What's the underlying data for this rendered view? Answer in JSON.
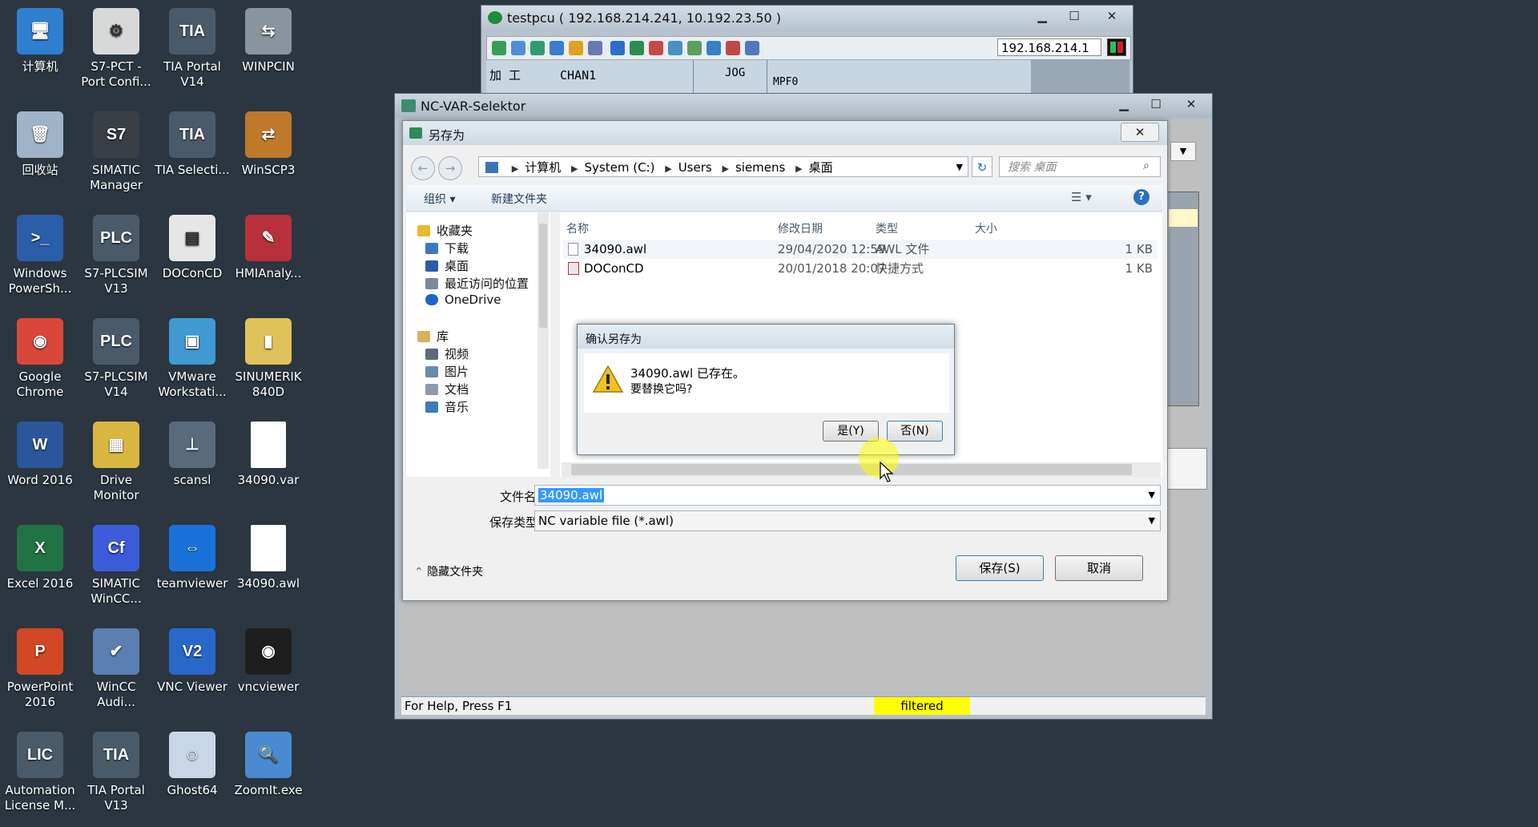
{
  "desktop": {
    "icons": [
      {
        "label": "计算机",
        "color": "#2f7fd0",
        "glyph": "🖥"
      },
      {
        "label": "S7-PCT - Port Confi...",
        "color": "#d8d8d8",
        "glyph": "⚙"
      },
      {
        "label": "TIA Portal V14",
        "color": "#4b5a69",
        "glyph": "TIA"
      },
      {
        "label": "WINPCIN",
        "color": "#8a949e",
        "glyph": "⇆"
      },
      {
        "label": "回收站",
        "color": "#9fb4c8",
        "glyph": "🗑"
      },
      {
        "label": "SIMATIC Manager",
        "color": "#3a3f46",
        "glyph": "S7"
      },
      {
        "label": "TIA Selecti...",
        "color": "#4b5a69",
        "glyph": "TIA"
      },
      {
        "label": "WinSCP3",
        "color": "#c0782a",
        "glyph": "⇄"
      },
      {
        "label": "Windows PowerSh...",
        "color": "#2a5ea8",
        "glyph": ">_"
      },
      {
        "label": "S7-PLCSIM V13",
        "color": "#4b5a69",
        "glyph": "PLC"
      },
      {
        "label": "DOConCD",
        "color": "#e6e6e6",
        "glyph": "▤"
      },
      {
        "label": "HMIAnaly...",
        "color": "#b8303a",
        "glyph": "✎"
      },
      {
        "label": "Google Chrome",
        "color": "#d9473a",
        "glyph": "◉"
      },
      {
        "label": "S7-PLCSIM V14",
        "color": "#4b5a69",
        "glyph": "PLC"
      },
      {
        "label": "VMware Workstati...",
        "color": "#3f9ad4",
        "glyph": "▣"
      },
      {
        "label": "SINUMERIK 840D",
        "color": "#e0c25a",
        "glyph": "▮"
      },
      {
        "label": "Word 2016",
        "color": "#2b579a",
        "glyph": "W"
      },
      {
        "label": "Drive Monitor",
        "color": "#d9b640",
        "glyph": "▦"
      },
      {
        "label": "scansl",
        "color": "#5a6a7a",
        "glyph": "⊥"
      },
      {
        "label": "34090.var",
        "color": "#ffffff",
        "glyph": ""
      },
      {
        "label": "Excel 2016",
        "color": "#217346",
        "glyph": "X"
      },
      {
        "label": "SIMATIC WinCC...",
        "color": "#3d5bd9",
        "glyph": "Cf"
      },
      {
        "label": "teamviewer",
        "color": "#1a72d8",
        "glyph": "⇔"
      },
      {
        "label": "34090.awl",
        "color": "#ffffff",
        "glyph": ""
      },
      {
        "label": "PowerPoint 2016",
        "color": "#d24726",
        "glyph": "P"
      },
      {
        "label": "WinCC Audi...",
        "color": "#5a7fb0",
        "glyph": "✔"
      },
      {
        "label": "VNC Viewer",
        "color": "#2868c8",
        "glyph": "V2"
      },
      {
        "label": "vncviewer",
        "color": "#1e1e1e",
        "glyph": "◉"
      },
      {
        "label": "Automation License M...",
        "color": "#4b5a69",
        "glyph": "LIC"
      },
      {
        "label": "TIA Portal V13",
        "color": "#4b5a69",
        "glyph": "TIA"
      },
      {
        "label": "Ghost64",
        "color": "#c8d6e6",
        "glyph": "☺"
      },
      {
        "label": "ZoomIt.exe",
        "color": "#4a8ad0",
        "glyph": "🔍"
      }
    ]
  },
  "testpcu": {
    "title": "testpcu ( 192.168.214.241, 10.192.23.50 )",
    "ip": "192.168.214.1",
    "hmi_mode": "加  工",
    "hmi_chan": "CHAN1",
    "hmi_op": "JOG",
    "hmi_prog": "MPF0"
  },
  "ncvar": {
    "title": "NC-VAR-Selektor",
    "status_help": "For Help, Press F1",
    "status_filtered": "filtered"
  },
  "saveas": {
    "title": "另存为",
    "breadcrumb": [
      "计算机",
      "System (C:)",
      "Users",
      "siemens",
      "桌面"
    ],
    "search_placeholder": "搜索 桌面",
    "organize": "组织 ▾",
    "new_folder": "新建文件夹",
    "nav": {
      "favorites": "收藏夹",
      "downloads": "下载",
      "desktop": "桌面",
      "recent": "最近访问的位置",
      "onedrive": "OneDrive",
      "library": "库",
      "videos": "视频",
      "pictures": "图片",
      "documents": "文档",
      "music": "音乐"
    },
    "columns": {
      "name": "名称",
      "date": "修改日期",
      "type": "类型",
      "size": "大小"
    },
    "files": [
      {
        "name": "34090.awl",
        "date": "29/04/2020 12:59",
        "type": "AWL 文件",
        "size": "1 KB"
      },
      {
        "name": "DOConCD",
        "date": "20/01/2018 20:07",
        "type": "快捷方式",
        "size": "1 KB"
      }
    ],
    "filename_label": "文件名(N):",
    "filename_value": "34090.awl",
    "filetype_label": "保存类型(T):",
    "filetype_value": "NC variable file (*.awl)",
    "hide_folders": "隐藏文件夹",
    "save_btn": "保存(S)",
    "cancel_btn": "取消"
  },
  "confirm": {
    "title": "确认另存为",
    "line1": "34090.awl 已存在。",
    "line2": "要替换它吗?",
    "yes": "是(Y)",
    "no": "否(N)"
  },
  "colors": {
    "highlight": "#ffff00",
    "selection": "#3399ff",
    "accent": "#2a6fc0"
  }
}
